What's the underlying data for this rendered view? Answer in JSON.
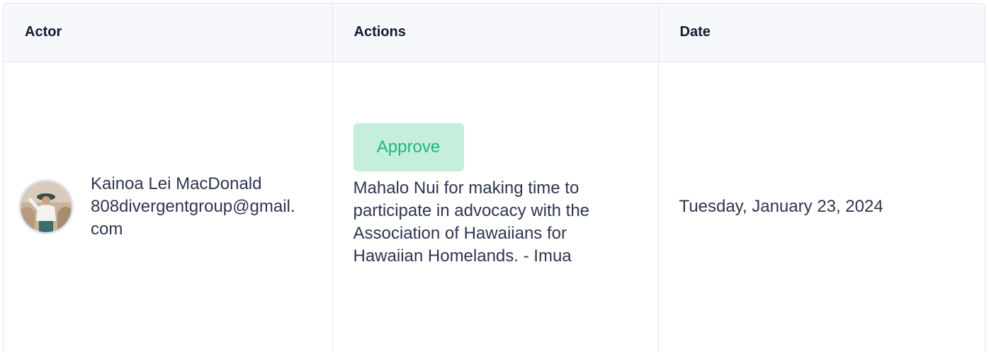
{
  "table": {
    "headers": [
      "Actor",
      "Actions",
      "Date"
    ],
    "rows": [
      {
        "actor_name": "Kainoa Lei MacDonald",
        "actor_email": "808divergentgroup@gmail.com",
        "action_badge": "Approve",
        "comment": "Mahalo Nui for making time to participate in advocacy with the Association of Hawaiians for Hawaiian Homelands. - Imua",
        "date": "Tuesday, January 23, 2024"
      }
    ]
  },
  "colors": {
    "approve_bg": "#c6eedd",
    "approve_text": "#1fb874",
    "header_bg": "#f7f8fc",
    "border": "#e3e6f0"
  }
}
